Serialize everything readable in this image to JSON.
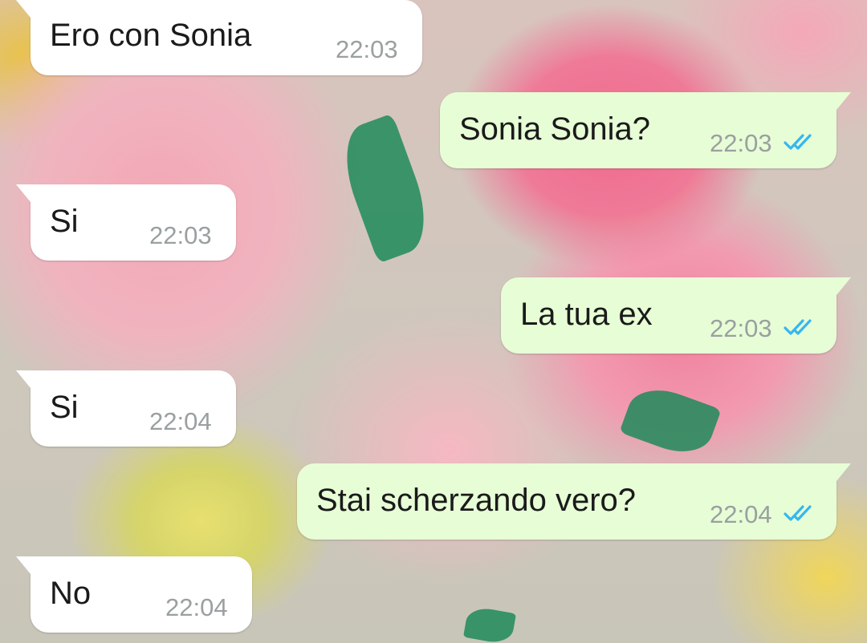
{
  "colors": {
    "incoming_bubble": "#ffffff",
    "outgoing_bubble": "#e7fdd6",
    "read_ticks": "#34b7f1",
    "time_text": "#9aa0a0"
  },
  "messages": [
    {
      "direction": "incoming",
      "text": "Ero con Sonia",
      "time": "22:03"
    },
    {
      "direction": "outgoing",
      "text": "Sonia Sonia?",
      "time": "22:03",
      "status": "read-double-tick-icon"
    },
    {
      "direction": "incoming",
      "text": "Si",
      "time": "22:03"
    },
    {
      "direction": "outgoing",
      "text": "La tua ex",
      "time": "22:03",
      "status": "read-double-tick-icon"
    },
    {
      "direction": "incoming",
      "text": "Si",
      "time": "22:04"
    },
    {
      "direction": "outgoing",
      "text": "Stai scherzando vero?",
      "time": "22:04",
      "status": "read-double-tick-icon"
    },
    {
      "direction": "incoming",
      "text": "No",
      "time": "22:04"
    }
  ]
}
